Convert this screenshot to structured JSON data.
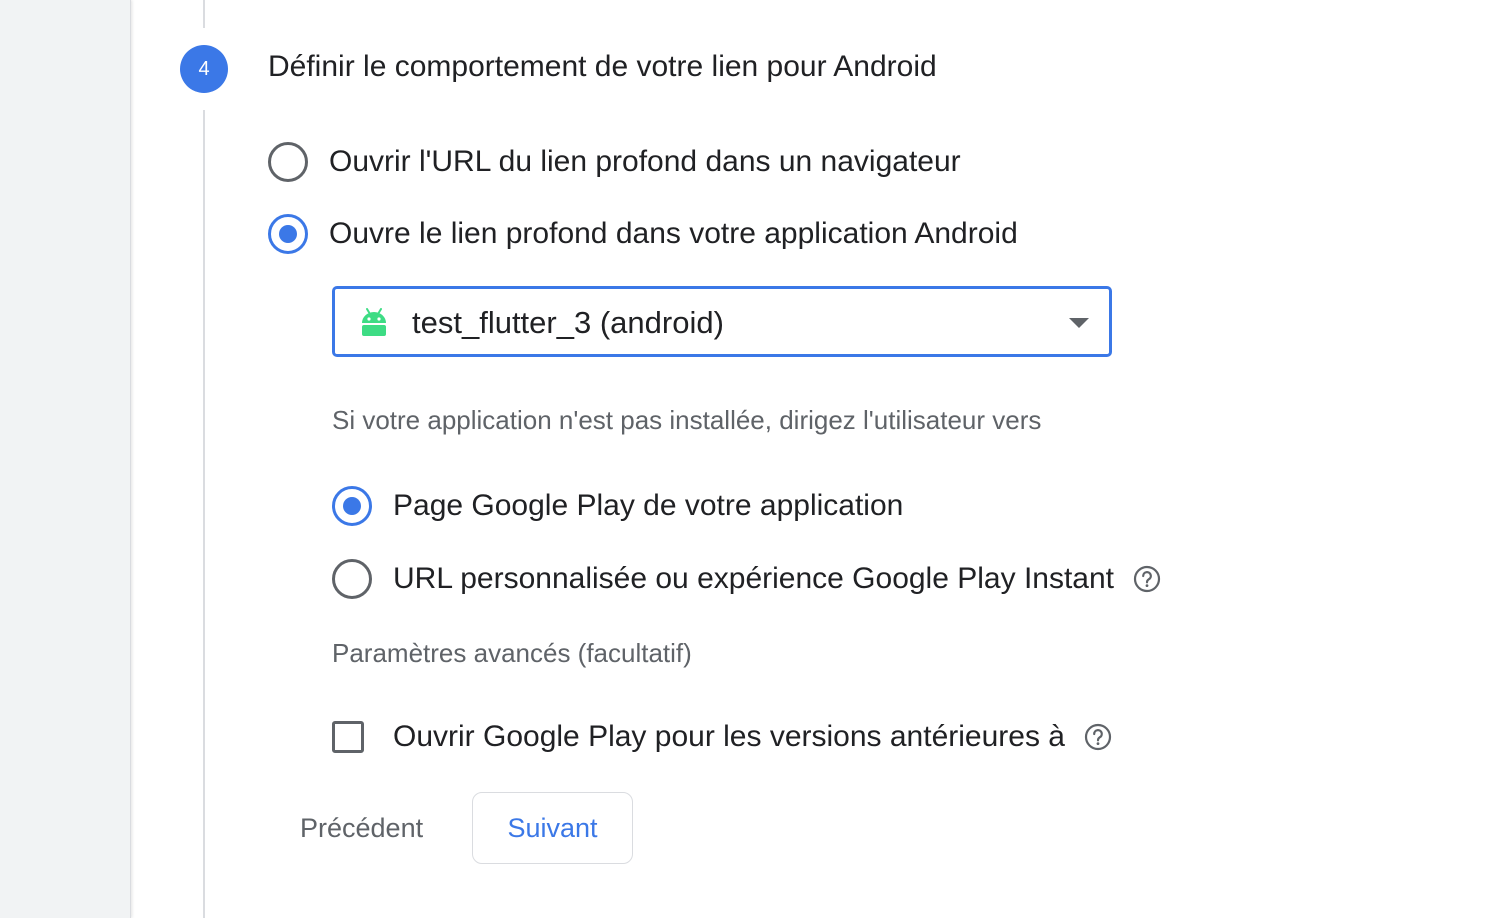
{
  "step": {
    "number": "4",
    "title": "Définir le comportement de votre lien pour Android"
  },
  "behavior_options": [
    {
      "label": "Ouvrir l'URL du lien profond dans un navigateur",
      "selected": false
    },
    {
      "label": "Ouvre le lien profond dans votre application Android",
      "selected": true
    }
  ],
  "app_select": {
    "value": "test_flutter_3 (android)",
    "icon": "android-icon"
  },
  "fallback": {
    "prompt": "Si votre application n'est pas installée, dirigez l'utilisateur vers",
    "options": [
      {
        "label": "Page Google Play de votre application",
        "selected": true
      },
      {
        "label": "URL personnalisée ou expérience Google Play Instant",
        "selected": false,
        "icon": "help-icon"
      }
    ]
  },
  "advanced": {
    "heading": "Paramètres avancés (facultatif)",
    "checkbox_label": "Ouvrir Google Play pour les versions antérieures à",
    "checked": false,
    "icon": "help-icon"
  },
  "buttons": {
    "previous": "Précédent",
    "next": "Suivant"
  },
  "colors": {
    "accent": "#3b78e7",
    "android_green": "#3ddc84"
  }
}
